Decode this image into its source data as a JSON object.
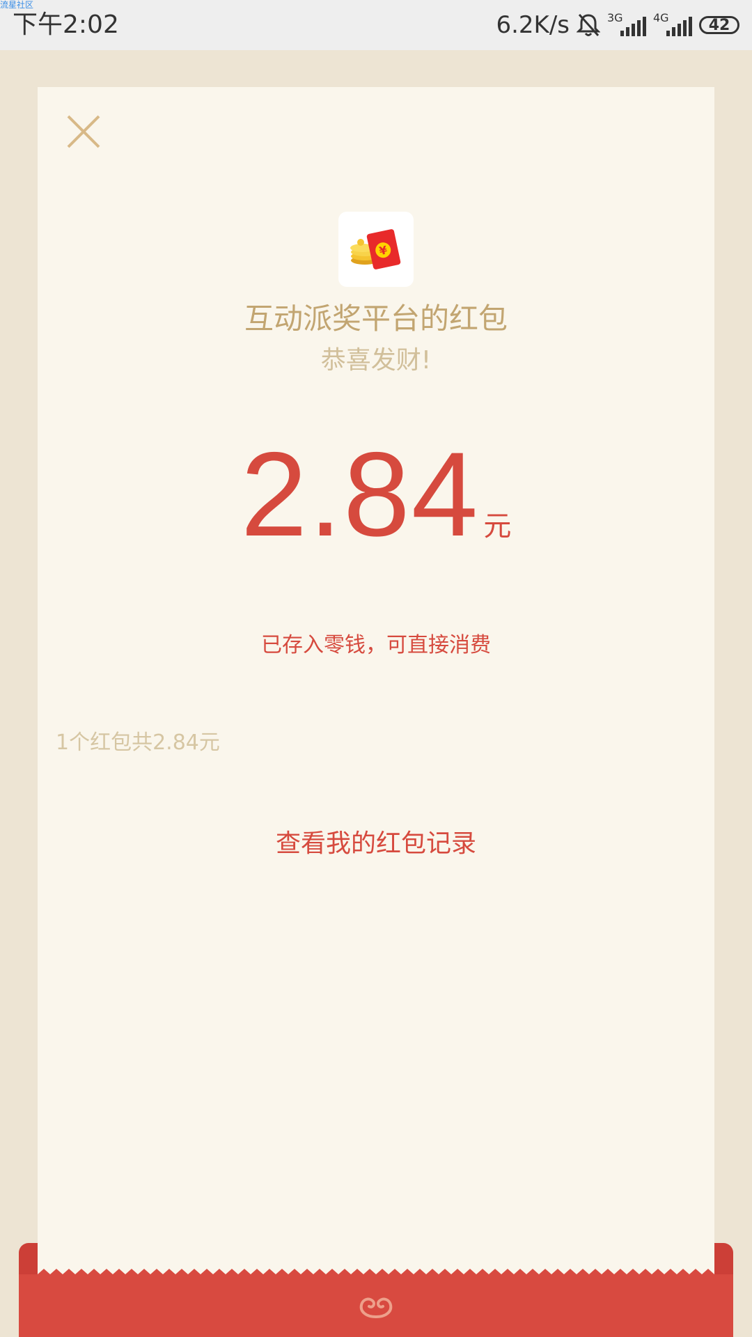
{
  "status_bar": {
    "watermark": "流星社区",
    "time": "下午2:02",
    "net_speed": "6.2K/s",
    "net1": "3G",
    "net2": "4G",
    "battery": "42"
  },
  "card": {
    "sender_name": "互动派奖平台的红包",
    "greeting": "恭喜发财!",
    "amount": "2.84",
    "amount_unit": "元",
    "deposit_note": "已存入零钱，可直接消费",
    "packet_summary": "1个红包共2.84元",
    "records_link": "查看我的红包记录"
  },
  "colors": {
    "accent_red": "#d64a3e",
    "gold_text": "#c2a571",
    "card_bg": "#faf6ec",
    "page_bg": "#ede4d3"
  },
  "icons": [
    "mute-bell-icon",
    "signal-icon",
    "battery-icon",
    "close-icon",
    "red-packet-app-icon",
    "cloud-ornament-icon"
  ]
}
